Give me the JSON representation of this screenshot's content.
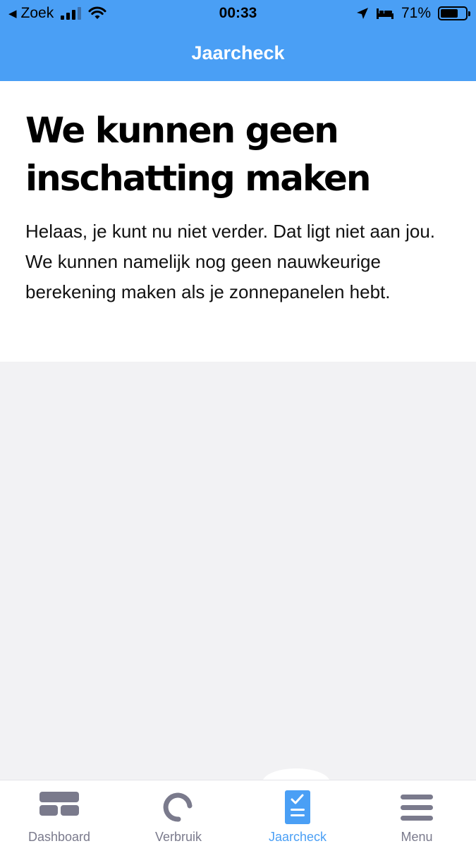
{
  "status_bar": {
    "back_label": "Zoek",
    "time": "00:33",
    "battery": "71%",
    "battery_level": 0.71
  },
  "nav": {
    "title": "Jaarcheck"
  },
  "content": {
    "heading": "We kunnen geen inschatting maken",
    "body": "Helaas, je kunt nu niet verder. Dat ligt niet aan jou. We kunnen namelijk nog geen nauwkeurige berekening maken als je zonnepanelen hebt."
  },
  "tabs": [
    {
      "label": "Dashboard",
      "icon": "dashboard-icon",
      "active": false
    },
    {
      "label": "Verbruik",
      "icon": "usage-ring-icon",
      "active": false
    },
    {
      "label": "Jaarcheck",
      "icon": "checklist-icon",
      "active": true
    },
    {
      "label": "Menu",
      "icon": "hamburger-icon",
      "active": false
    }
  ],
  "colors": {
    "accent": "#4a9ff5",
    "tab_inactive": "#7a7a8c",
    "background": "#f2f2f4"
  }
}
